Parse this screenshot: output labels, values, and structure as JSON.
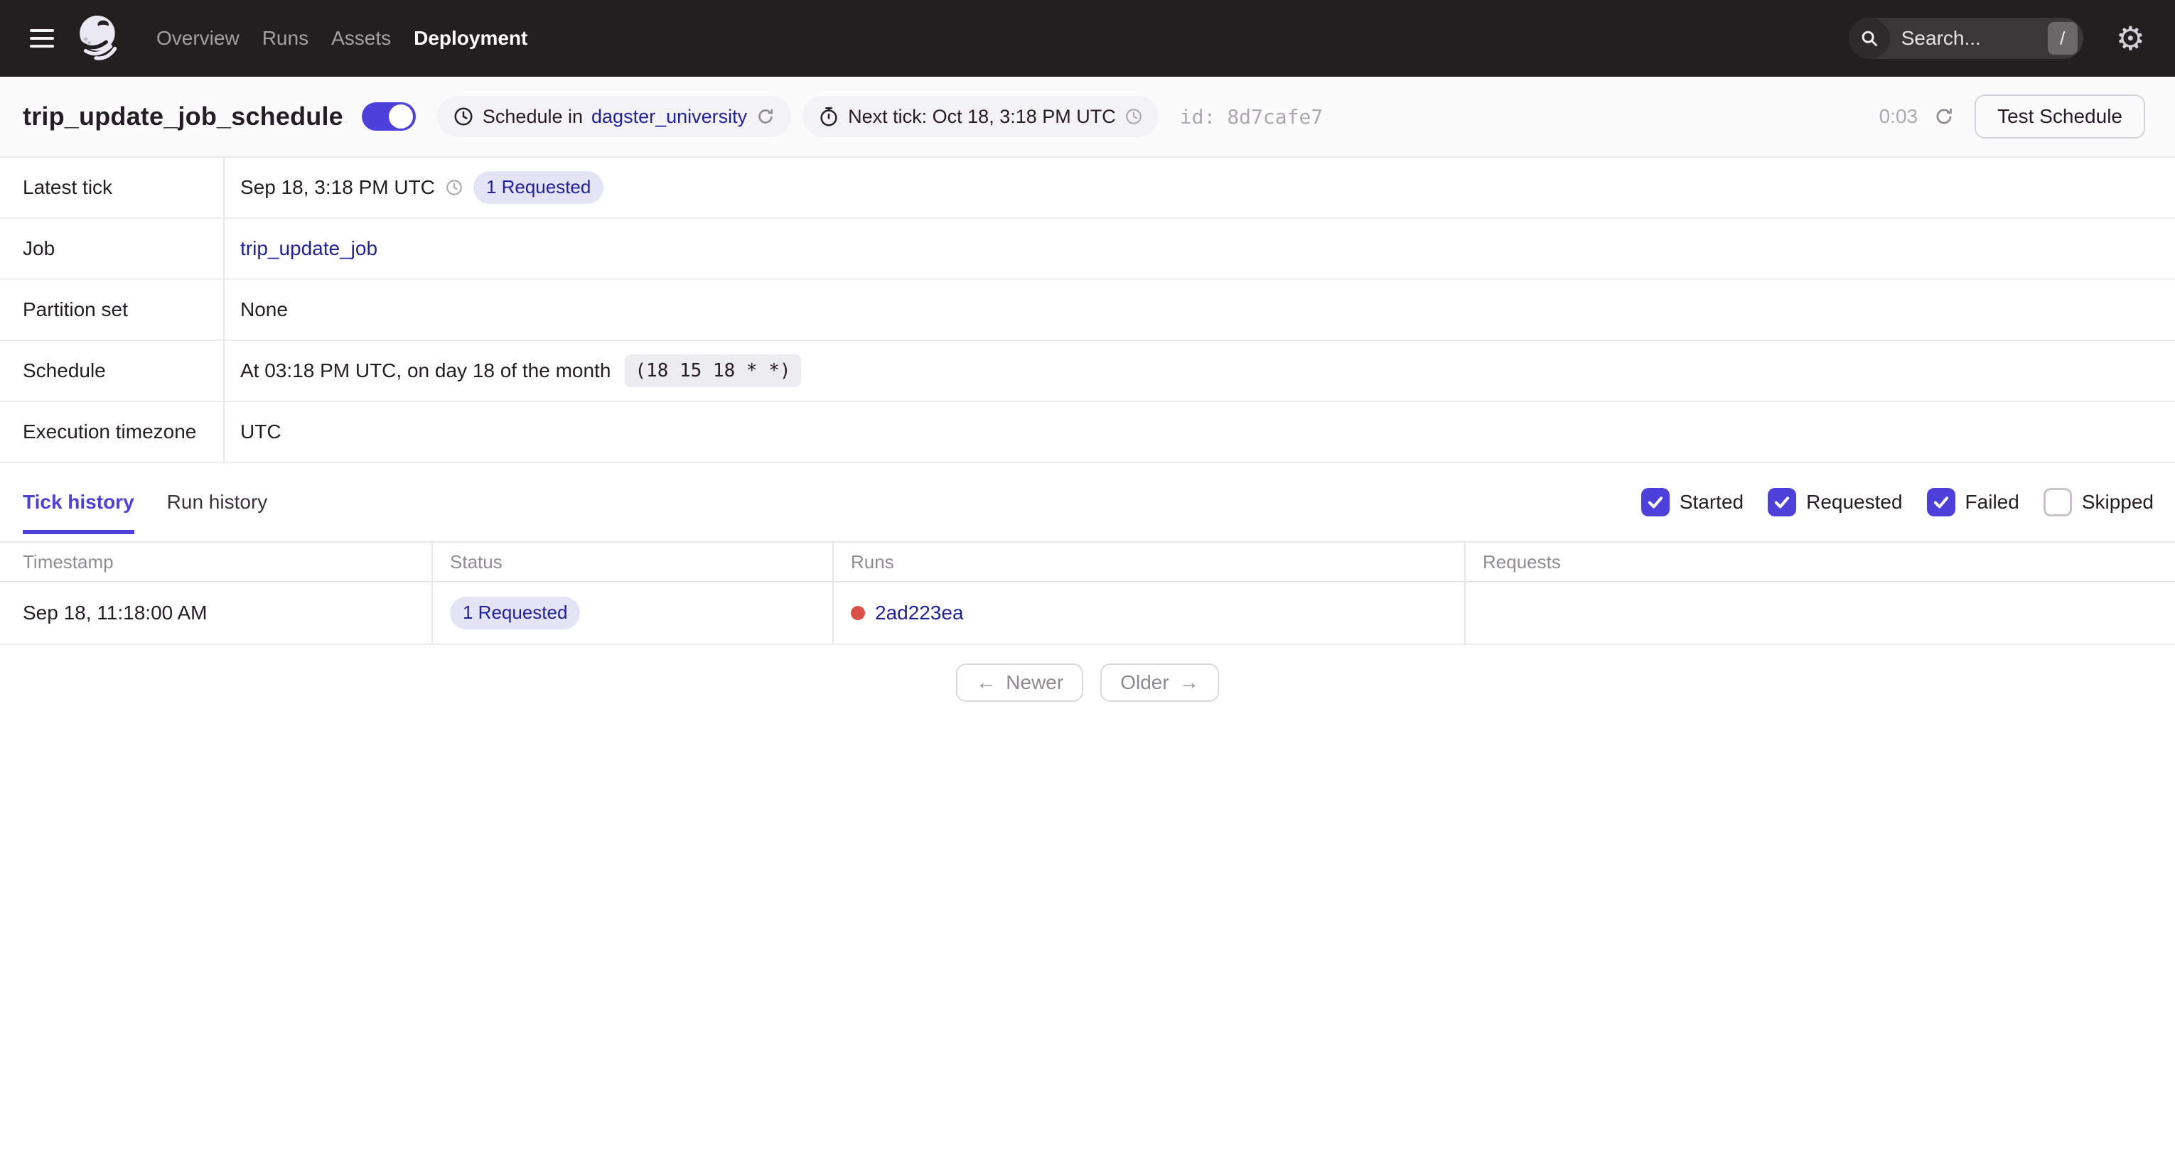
{
  "nav": {
    "items": [
      {
        "label": "Overview",
        "active": false
      },
      {
        "label": "Runs",
        "active": false
      },
      {
        "label": "Assets",
        "active": false
      },
      {
        "label": "Deployment",
        "active": true
      }
    ],
    "search": {
      "placeholder": "Search...",
      "shortcut": "/"
    }
  },
  "header": {
    "title": "trip_update_job_schedule",
    "toggle_on": true,
    "schedule_pill": {
      "text": "Schedule in",
      "link": "dagster_university"
    },
    "next_tick_pill": {
      "text": "Next tick: Oct 18, 3:18 PM UTC"
    },
    "id_label": "id:",
    "id_value": "8d7cafe7",
    "countdown": "0:03",
    "test_button": "Test Schedule"
  },
  "meta": {
    "rows": [
      {
        "label": "Latest tick",
        "value": "Sep 18, 3:18 PM UTC",
        "badge": "1 Requested"
      },
      {
        "label": "Job",
        "link": "trip_update_job"
      },
      {
        "label": "Partition set",
        "value": "None"
      },
      {
        "label": "Schedule",
        "value": "At 03:18 PM UTC, on day 18 of the month",
        "cron": "(18 15 18 * *)"
      },
      {
        "label": "Execution timezone",
        "value": "UTC"
      }
    ]
  },
  "history": {
    "tabs": [
      {
        "label": "Tick history",
        "active": true
      },
      {
        "label": "Run history",
        "active": false
      }
    ],
    "filters": [
      {
        "label": "Started",
        "checked": true
      },
      {
        "label": "Requested",
        "checked": true
      },
      {
        "label": "Failed",
        "checked": true
      },
      {
        "label": "Skipped",
        "checked": false
      }
    ],
    "table": {
      "columns": [
        "Timestamp",
        "Status",
        "Runs",
        "Requests"
      ],
      "rows": [
        {
          "timestamp": "Sep 18, 11:18:00 AM",
          "status_badge": "1 Requested",
          "run_id": "2ad223ea",
          "requests": ""
        }
      ]
    },
    "pagination": {
      "newer": "Newer",
      "older": "Older"
    }
  },
  "icons": {
    "gear": "⚙",
    "arrow_left": "←",
    "arrow_right": "→"
  },
  "colors": {
    "accent": "#4E40DB",
    "link": "#21219B",
    "nav_bg": "#231F20",
    "badge_bg": "#E5E4F6",
    "run_failed_dot": "#DB5149"
  }
}
